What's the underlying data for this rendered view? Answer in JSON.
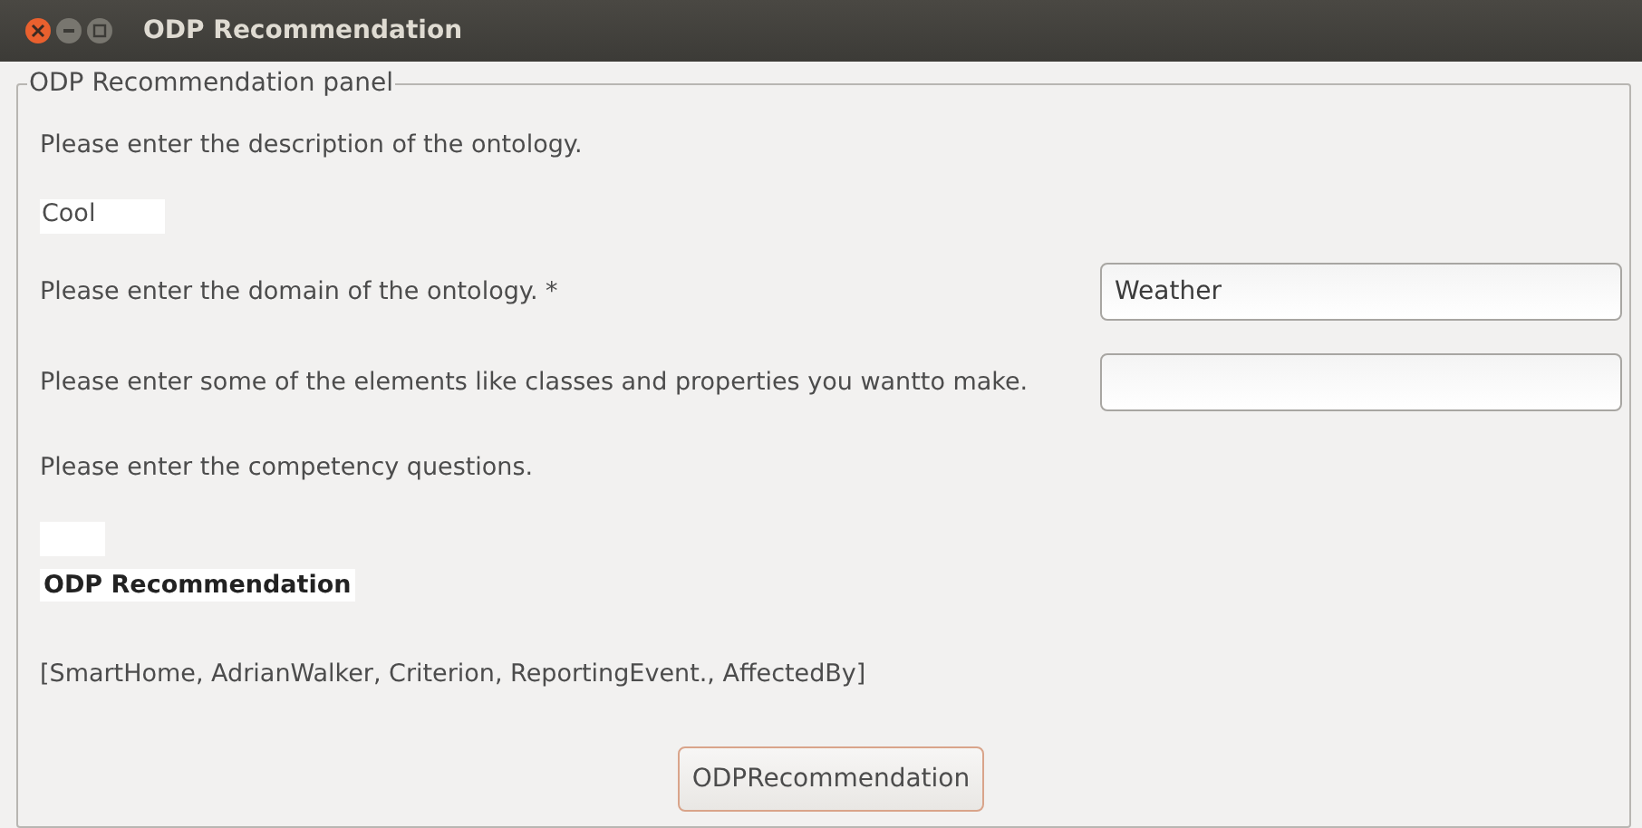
{
  "window": {
    "title": "ODP Recommendation"
  },
  "panel": {
    "title": "ODP Recommendation panel",
    "rows": [
      {
        "kind": "label",
        "text": "Please enter the description of the ontology."
      },
      {
        "kind": "area",
        "value": "Cool"
      },
      {
        "kind": "field",
        "text": "Please enter the domain of the ontology. *",
        "value": "Weather"
      },
      {
        "kind": "field",
        "text": "Please enter some of the elements like classes and properties you wantto make.",
        "value": ""
      },
      {
        "kind": "label",
        "text": "Please enter the competency questions."
      },
      {
        "kind": "area",
        "value": ""
      },
      {
        "kind": "heading",
        "text": "ODP Recommendation"
      },
      {
        "kind": "label",
        "text": "[SmartHome, AdrianWalker, Criterion, ReportingEvent., AffectedBy]"
      }
    ],
    "button": "ODPRecommendation"
  }
}
